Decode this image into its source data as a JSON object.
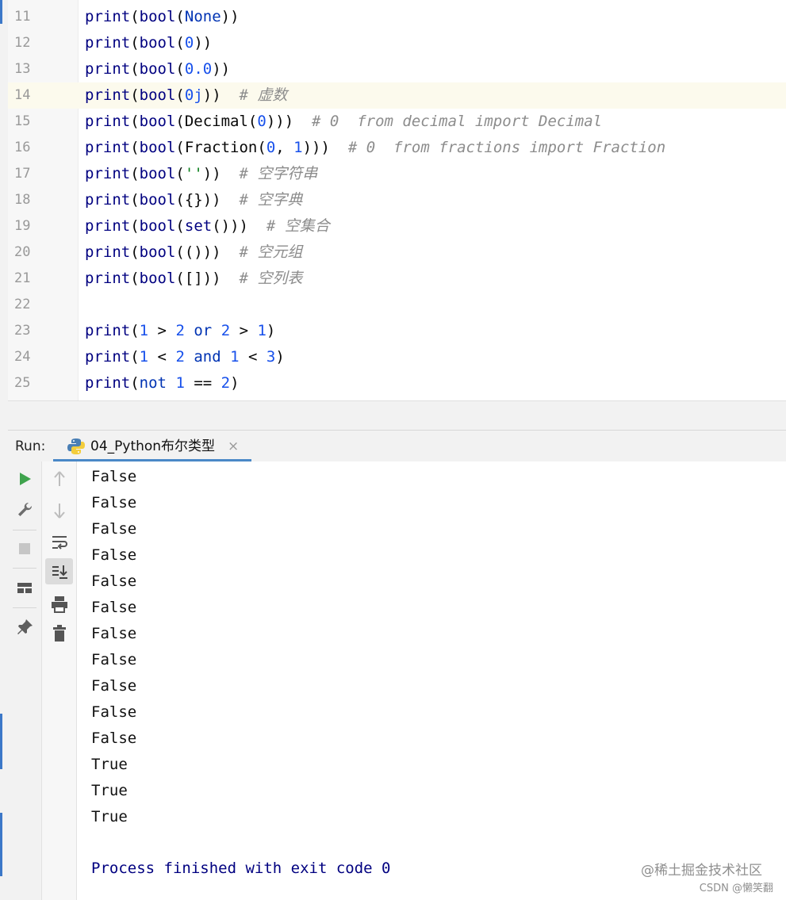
{
  "editor": {
    "lines": [
      {
        "num": "11",
        "tokens": [
          [
            "fn",
            "print"
          ],
          [
            "p",
            "("
          ],
          [
            "fn",
            "bool"
          ],
          [
            "p",
            "("
          ],
          [
            "kw",
            "None"
          ],
          [
            "p",
            "))"
          ]
        ]
      },
      {
        "num": "12",
        "tokens": [
          [
            "fn",
            "print"
          ],
          [
            "p",
            "("
          ],
          [
            "fn",
            "bool"
          ],
          [
            "p",
            "("
          ],
          [
            "num",
            "0"
          ],
          [
            "p",
            "))"
          ]
        ]
      },
      {
        "num": "13",
        "tokens": [
          [
            "fn",
            "print"
          ],
          [
            "p",
            "("
          ],
          [
            "fn",
            "bool"
          ],
          [
            "p",
            "("
          ],
          [
            "num",
            "0.0"
          ],
          [
            "p",
            "))"
          ]
        ]
      },
      {
        "num": "14",
        "current": true,
        "tokens": [
          [
            "fn",
            "print"
          ],
          [
            "p",
            "("
          ],
          [
            "fn",
            "bool"
          ],
          [
            "p",
            "("
          ],
          [
            "num",
            "0j"
          ],
          [
            "p",
            "))  "
          ],
          [
            "cm",
            "# 虚数"
          ]
        ]
      },
      {
        "num": "15",
        "tokens": [
          [
            "fn",
            "print"
          ],
          [
            "p",
            "("
          ],
          [
            "fn",
            "bool"
          ],
          [
            "p",
            "(Decimal("
          ],
          [
            "num",
            "0"
          ],
          [
            "p",
            ")))  "
          ],
          [
            "cm",
            "# 0  from decimal import Decimal"
          ]
        ]
      },
      {
        "num": "16",
        "tokens": [
          [
            "fn",
            "print"
          ],
          [
            "p",
            "("
          ],
          [
            "fn",
            "bool"
          ],
          [
            "p",
            "(Fraction("
          ],
          [
            "num",
            "0"
          ],
          [
            "p",
            ", "
          ],
          [
            "num",
            "1"
          ],
          [
            "p",
            ")))  "
          ],
          [
            "cm",
            "# 0  from fractions import Fraction"
          ]
        ]
      },
      {
        "num": "17",
        "tokens": [
          [
            "fn",
            "print"
          ],
          [
            "p",
            "("
          ],
          [
            "fn",
            "bool"
          ],
          [
            "p",
            "("
          ],
          [
            "str",
            "''"
          ],
          [
            "p",
            "))  "
          ],
          [
            "cm",
            "# 空字符串"
          ]
        ]
      },
      {
        "num": "18",
        "tokens": [
          [
            "fn",
            "print"
          ],
          [
            "p",
            "("
          ],
          [
            "fn",
            "bool"
          ],
          [
            "p",
            "({}))  "
          ],
          [
            "cm",
            "# 空字典"
          ]
        ]
      },
      {
        "num": "19",
        "tokens": [
          [
            "fn",
            "print"
          ],
          [
            "p",
            "("
          ],
          [
            "fn",
            "bool"
          ],
          [
            "p",
            "("
          ],
          [
            "fn",
            "set"
          ],
          [
            "p",
            "()))  "
          ],
          [
            "cm",
            "# 空集合"
          ]
        ]
      },
      {
        "num": "20",
        "tokens": [
          [
            "fn",
            "print"
          ],
          [
            "p",
            "("
          ],
          [
            "fn",
            "bool"
          ],
          [
            "p",
            "(()))  "
          ],
          [
            "cm",
            "# 空元组"
          ]
        ]
      },
      {
        "num": "21",
        "tokens": [
          [
            "fn",
            "print"
          ],
          [
            "p",
            "("
          ],
          [
            "fn",
            "bool"
          ],
          [
            "p",
            "([]))  "
          ],
          [
            "cm",
            "# 空列表"
          ]
        ]
      },
      {
        "num": "22",
        "tokens": []
      },
      {
        "num": "23",
        "tokens": [
          [
            "fn",
            "print"
          ],
          [
            "p",
            "("
          ],
          [
            "num",
            "1"
          ],
          [
            "p",
            " > "
          ],
          [
            "num",
            "2"
          ],
          [
            "p",
            " "
          ],
          [
            "kw",
            "or"
          ],
          [
            "p",
            " "
          ],
          [
            "num",
            "2"
          ],
          [
            "p",
            " > "
          ],
          [
            "num",
            "1"
          ],
          [
            "p",
            ")"
          ]
        ]
      },
      {
        "num": "24",
        "tokens": [
          [
            "fn",
            "print"
          ],
          [
            "p",
            "("
          ],
          [
            "num",
            "1"
          ],
          [
            "p",
            " < "
          ],
          [
            "num",
            "2"
          ],
          [
            "p",
            " "
          ],
          [
            "kw",
            "and"
          ],
          [
            "p",
            " "
          ],
          [
            "num",
            "1"
          ],
          [
            "p",
            " < "
          ],
          [
            "num",
            "3"
          ],
          [
            "p",
            ")"
          ]
        ]
      },
      {
        "num": "25",
        "tokens": [
          [
            "fn",
            "print"
          ],
          [
            "p",
            "("
          ],
          [
            "kw",
            "not"
          ],
          [
            "p",
            " "
          ],
          [
            "num",
            "1"
          ],
          [
            "p",
            " == "
          ],
          [
            "num",
            "2"
          ],
          [
            "p",
            ")"
          ]
        ]
      }
    ]
  },
  "run": {
    "label": "Run:",
    "tab_title": "04_Python布尔类型",
    "tab_close": "×"
  },
  "console": {
    "lines": [
      "False",
      "False",
      "False",
      "False",
      "False",
      "False",
      "False",
      "False",
      "False",
      "False",
      "False",
      "True",
      "True",
      "True"
    ],
    "process_line": "Process finished with exit code 0"
  },
  "watermark": {
    "line1": "@稀土掘金技术社区",
    "line2": "CSDN @懒笑翻"
  },
  "colors": {
    "keyword": "#0033b3",
    "number": "#1750eb",
    "function": "#000080",
    "string": "#067d17",
    "comment": "#8c8c8c",
    "current_line": "#fcfaed",
    "tab_accent": "#4a88c7",
    "run_icon": "#3fa34d"
  },
  "icons": {
    "tool_window": [
      "run-icon",
      "wrench-icon",
      "stop-icon",
      "layout-icon",
      "pin-icon"
    ],
    "console_tools": [
      "arrow-up-icon",
      "arrow-down-icon",
      "soft-wrap-icon",
      "scroll-to-end-icon",
      "print-icon",
      "trash-icon"
    ]
  }
}
